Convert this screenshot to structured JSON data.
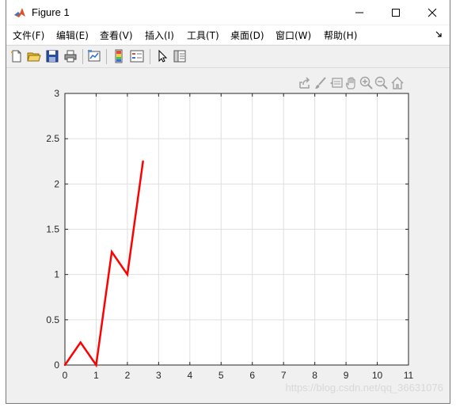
{
  "window": {
    "title": "Figure 1",
    "controls": {
      "minimize": "minimize",
      "maximize": "maximize",
      "close": "close"
    }
  },
  "menubar": {
    "items": [
      {
        "label": "文件(F)"
      },
      {
        "label": "编辑(E)"
      },
      {
        "label": "查看(V)"
      },
      {
        "label": "插入(I)"
      },
      {
        "label": "工具(T)"
      },
      {
        "label": "桌面(D)"
      },
      {
        "label": "窗口(W)"
      },
      {
        "label": "帮助(H)"
      }
    ]
  },
  "toolbar": {
    "icons": [
      "new-figure-icon",
      "open-file-icon",
      "save-icon",
      "print-icon",
      "link-plot-icon",
      "insert-colorbar-icon",
      "insert-legend-icon",
      "edit-plot-icon",
      "property-inspector-icon"
    ]
  },
  "axes_toolbar": {
    "icons": [
      "export-icon",
      "brush-icon",
      "data-tips-icon",
      "pan-icon",
      "zoom-in-icon",
      "zoom-out-icon",
      "home-icon"
    ]
  },
  "chart_data": {
    "type": "line",
    "title": "",
    "xlabel": "",
    "ylabel": "",
    "xlim": [
      0,
      11
    ],
    "ylim": [
      0,
      3
    ],
    "xticks": [
      "0",
      "1",
      "2",
      "3",
      "4",
      "5",
      "6",
      "7",
      "8",
      "9",
      "10",
      "11"
    ],
    "yticks": [
      "0",
      "0.5",
      "1",
      "1.5",
      "2",
      "2.5",
      "3"
    ],
    "grid": true,
    "series": [
      {
        "color": "#ff0000",
        "x": [
          0,
          0.5,
          1,
          1.5,
          2,
          2.5
        ],
        "y": [
          0,
          0.25,
          0,
          1.25,
          1,
          2.25
        ]
      }
    ]
  },
  "watermark": "https://blog.csdn.net/qq_36631076"
}
